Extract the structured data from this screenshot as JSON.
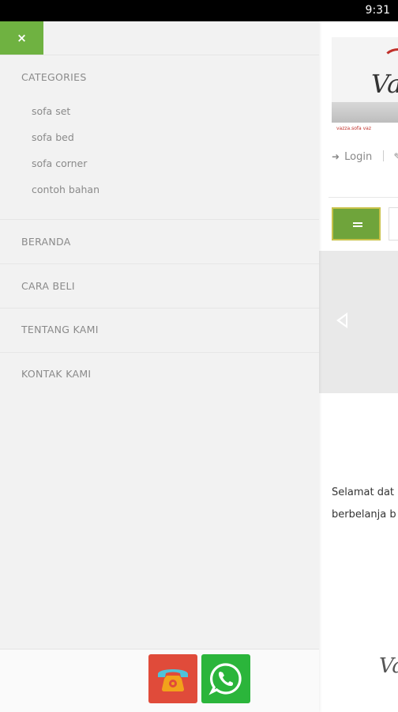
{
  "status_bar": {
    "time": "9:31"
  },
  "drawer": {
    "close_label": "×",
    "categories_title": "CATEGORIES",
    "categories": [
      {
        "label": "sofa set"
      },
      {
        "label": "sofa bed"
      },
      {
        "label": "sofa corner"
      },
      {
        "label": "contoh bahan"
      }
    ],
    "nav": [
      {
        "label": "BERANDA"
      },
      {
        "label": "CARA BELI"
      },
      {
        "label": "TENTANG KAMI"
      },
      {
        "label": "KONTAK KAMI"
      }
    ]
  },
  "page": {
    "banner_logo": "Va",
    "banner_strip": "vazza.sofa   vaz",
    "login_label": "Login",
    "welcome_line1": "Selamat dat",
    "welcome_line2": "berbelanja b",
    "footer_logo": "Va"
  },
  "contact_bar": {
    "call_icon": "phone-icon",
    "whatsapp_icon": "whatsapp-icon"
  },
  "colors": {
    "accent_green": "#6fb241",
    "call_red": "#e04b3a",
    "whatsapp_green": "#2bb53b"
  }
}
